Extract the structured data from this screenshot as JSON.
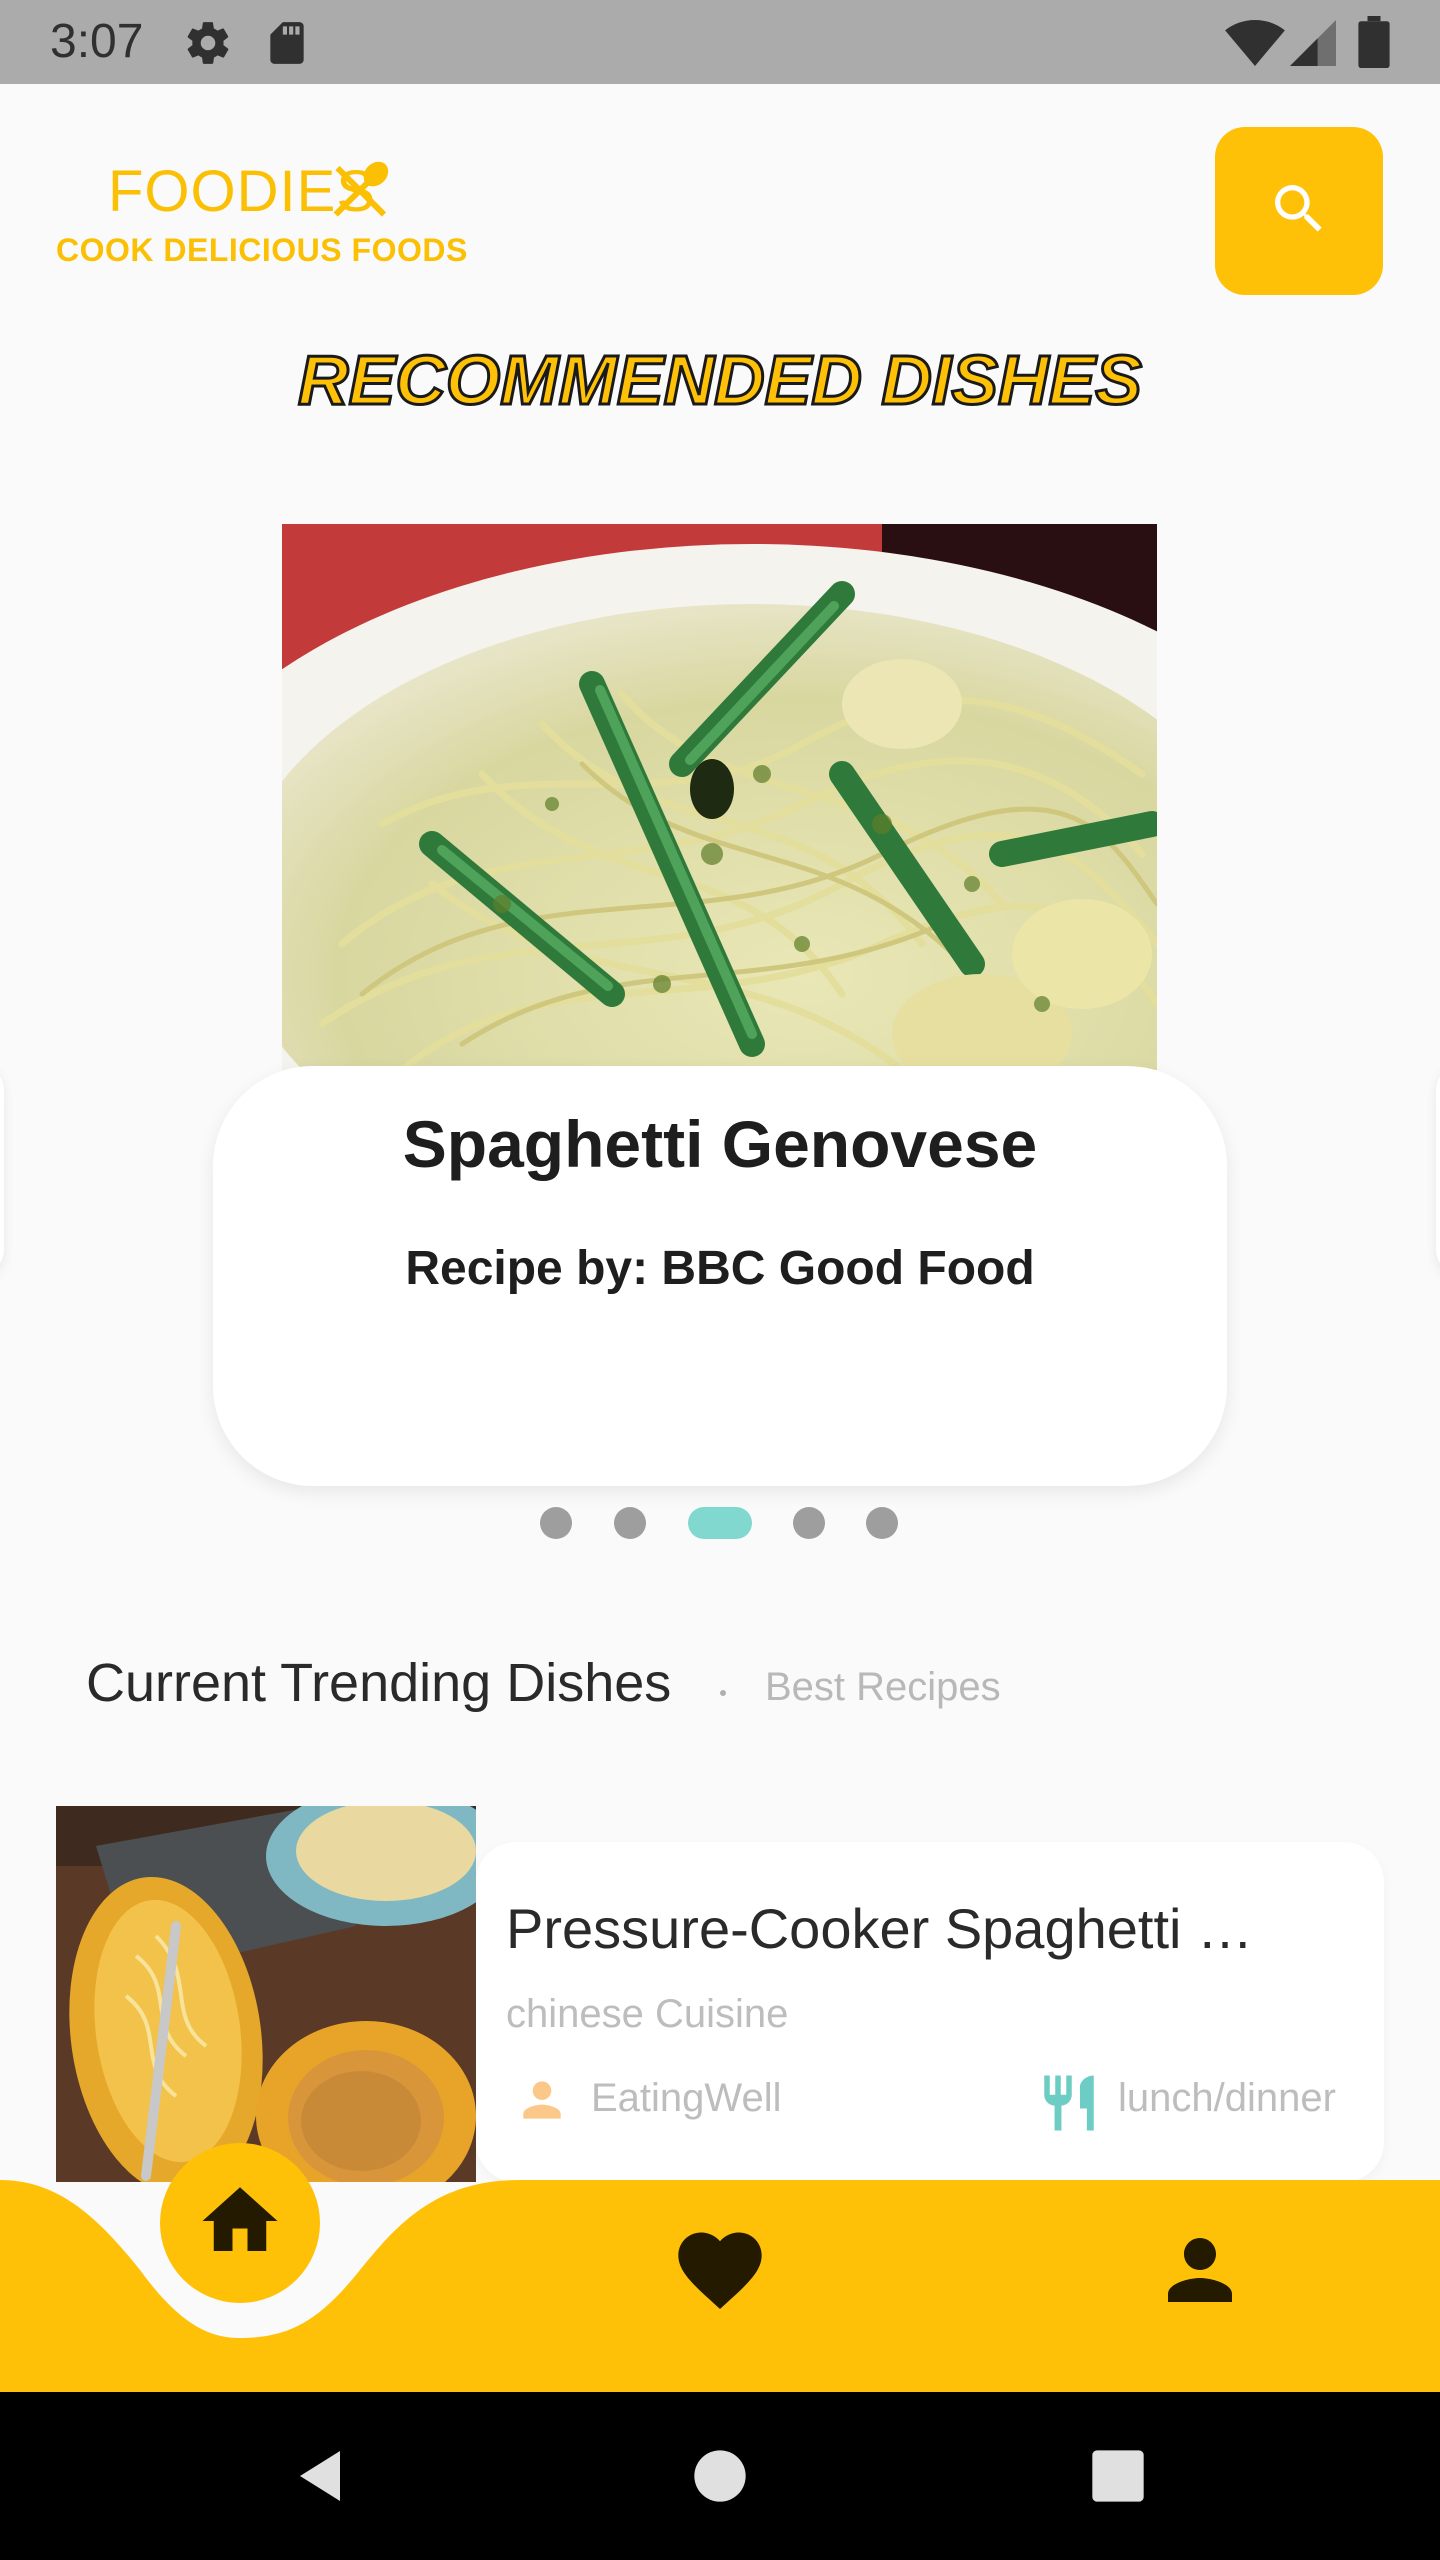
{
  "status_bar": {
    "time": "3:07",
    "icons": [
      "settings-icon",
      "sd-card-icon",
      "wifi-icon",
      "signal-icon",
      "battery-icon"
    ]
  },
  "header": {
    "brand_name": "FOODIES",
    "brand_tagline": "COOK DELICIOUS FOODS",
    "logo_icon": "fork-spoon-icon",
    "search_icon": "search-icon"
  },
  "recommended": {
    "title": "RECOMMENDED DISHES",
    "dish": {
      "name": "Spaghetti Genovese",
      "recipe_by": "Recipe by: BBC Good Food",
      "image": "spaghetti-genovese-photo"
    },
    "pager": {
      "count": 5,
      "active_index": 2
    }
  },
  "trending": {
    "heading": "Current Trending Dishes",
    "subheading": "Best Recipes",
    "items": [
      {
        "title": "Pressure-Cooker Spaghetti …",
        "cuisine": "chinese Cuisine",
        "author": "EatingWell",
        "meal": "lunch/dinner",
        "image": "spaghetti-squash-photo"
      }
    ]
  },
  "bottom_nav": {
    "items": [
      "home-icon",
      "heart-icon",
      "person-icon"
    ],
    "active": "home-icon"
  },
  "colors": {
    "accent": "#fec107",
    "brand_text": "#fbbf04",
    "pager_active": "#80d8cf",
    "meal_icon": "#6dcdc4",
    "author_icon": "#fcc88a"
  }
}
